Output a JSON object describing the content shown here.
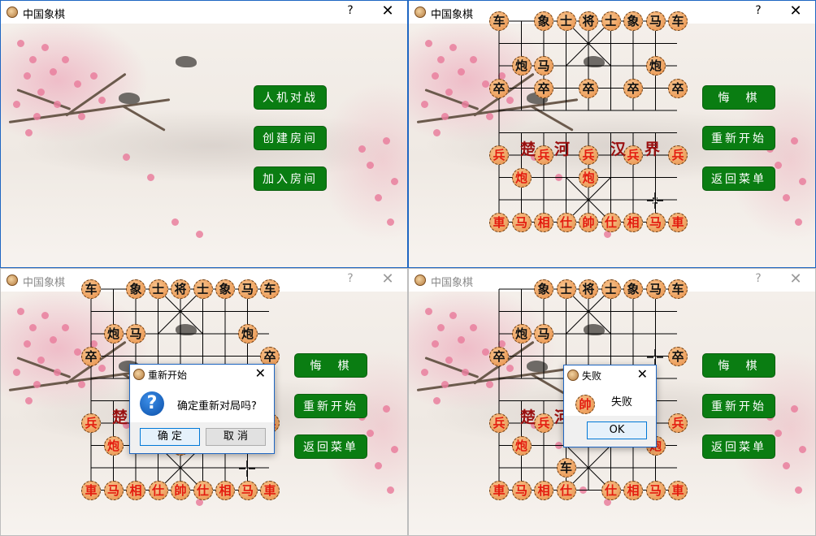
{
  "app": {
    "title": "中国象棋",
    "help_glyph": "?",
    "close_glyph": "✕"
  },
  "menu_window": {
    "buttons": [
      {
        "label": "人机对战"
      },
      {
        "label": "创建房间"
      },
      {
        "label": "加入房间"
      }
    ]
  },
  "game_buttons": [
    {
      "label": "悔　棋"
    },
    {
      "label": "重新开始"
    },
    {
      "label": "返回菜单"
    }
  ],
  "river": {
    "left": "楚　河",
    "right": "汉　界"
  },
  "boards": [
    {
      "pieces": [
        {
          "t": "车",
          "s": "black",
          "c": 0,
          "r": 0
        },
        {
          "t": "象",
          "s": "black",
          "c": 2,
          "r": 0
        },
        {
          "t": "士",
          "s": "black",
          "c": 3,
          "r": 0
        },
        {
          "t": "将",
          "s": "black",
          "c": 4,
          "r": 0
        },
        {
          "t": "士",
          "s": "black",
          "c": 5,
          "r": 0
        },
        {
          "t": "象",
          "s": "black",
          "c": 6,
          "r": 0
        },
        {
          "t": "马",
          "s": "black",
          "c": 7,
          "r": 0
        },
        {
          "t": "车",
          "s": "black",
          "c": 8,
          "r": 0
        },
        {
          "t": "炮",
          "s": "black",
          "c": 1,
          "r": 2
        },
        {
          "t": "马",
          "s": "black",
          "c": 2,
          "r": 2
        },
        {
          "t": "炮",
          "s": "black",
          "c": 7,
          "r": 2
        },
        {
          "t": "卒",
          "s": "black",
          "c": 0,
          "r": 3
        },
        {
          "t": "卒",
          "s": "black",
          "c": 2,
          "r": 3
        },
        {
          "t": "卒",
          "s": "black",
          "c": 4,
          "r": 3
        },
        {
          "t": "卒",
          "s": "black",
          "c": 6,
          "r": 3
        },
        {
          "t": "卒",
          "s": "black",
          "c": 8,
          "r": 3
        },
        {
          "t": "兵",
          "s": "red",
          "c": 0,
          "r": 6
        },
        {
          "t": "兵",
          "s": "red",
          "c": 2,
          "r": 6
        },
        {
          "t": "兵",
          "s": "red",
          "c": 4,
          "r": 6
        },
        {
          "t": "兵",
          "s": "red",
          "c": 6,
          "r": 6
        },
        {
          "t": "兵",
          "s": "red",
          "c": 8,
          "r": 6
        },
        {
          "t": "炮",
          "s": "red",
          "c": 1,
          "r": 7
        },
        {
          "t": "炮",
          "s": "red",
          "c": 4,
          "r": 7
        },
        {
          "t": "車",
          "s": "red",
          "c": 0,
          "r": 9
        },
        {
          "t": "马",
          "s": "red",
          "c": 1,
          "r": 9
        },
        {
          "t": "相",
          "s": "red",
          "c": 2,
          "r": 9
        },
        {
          "t": "仕",
          "s": "red",
          "c": 3,
          "r": 9
        },
        {
          "t": "帥",
          "s": "red",
          "c": 4,
          "r": 9
        },
        {
          "t": "仕",
          "s": "red",
          "c": 5,
          "r": 9
        },
        {
          "t": "相",
          "s": "red",
          "c": 6,
          "r": 9
        },
        {
          "t": "马",
          "s": "red",
          "c": 7,
          "r": 9
        },
        {
          "t": "車",
          "s": "red",
          "c": 8,
          "r": 9
        }
      ]
    },
    {
      "pieces": [
        {
          "t": "车",
          "s": "black",
          "c": 0,
          "r": 0
        },
        {
          "t": "象",
          "s": "black",
          "c": 2,
          "r": 0
        },
        {
          "t": "士",
          "s": "black",
          "c": 3,
          "r": 0
        },
        {
          "t": "将",
          "s": "black",
          "c": 4,
          "r": 0
        },
        {
          "t": "士",
          "s": "black",
          "c": 5,
          "r": 0
        },
        {
          "t": "象",
          "s": "black",
          "c": 6,
          "r": 0
        },
        {
          "t": "马",
          "s": "black",
          "c": 7,
          "r": 0
        },
        {
          "t": "车",
          "s": "black",
          "c": 8,
          "r": 0
        },
        {
          "t": "炮",
          "s": "black",
          "c": 1,
          "r": 2
        },
        {
          "t": "马",
          "s": "black",
          "c": 2,
          "r": 2
        },
        {
          "t": "炮",
          "s": "black",
          "c": 7,
          "r": 2
        },
        {
          "t": "卒",
          "s": "black",
          "c": 0,
          "r": 3
        },
        {
          "t": "卒",
          "s": "black",
          "c": 8,
          "r": 3
        },
        {
          "t": "兵",
          "s": "red",
          "c": 0,
          "r": 6
        },
        {
          "t": "兵",
          "s": "red",
          "c": 8,
          "r": 6
        },
        {
          "t": "炮",
          "s": "red",
          "c": 1,
          "r": 7
        },
        {
          "t": "炮",
          "s": "red",
          "c": 4,
          "r": 7
        },
        {
          "t": "車",
          "s": "red",
          "c": 0,
          "r": 9
        },
        {
          "t": "马",
          "s": "red",
          "c": 1,
          "r": 9
        },
        {
          "t": "相",
          "s": "red",
          "c": 2,
          "r": 9
        },
        {
          "t": "仕",
          "s": "red",
          "c": 3,
          "r": 9
        },
        {
          "t": "帥",
          "s": "red",
          "c": 4,
          "r": 9
        },
        {
          "t": "仕",
          "s": "red",
          "c": 5,
          "r": 9
        },
        {
          "t": "相",
          "s": "red",
          "c": 6,
          "r": 9
        },
        {
          "t": "马",
          "s": "red",
          "c": 7,
          "r": 9
        },
        {
          "t": "車",
          "s": "red",
          "c": 8,
          "r": 9
        }
      ]
    },
    {
      "pieces": [
        {
          "t": "象",
          "s": "black",
          "c": 2,
          "r": 0
        },
        {
          "t": "士",
          "s": "black",
          "c": 3,
          "r": 0
        },
        {
          "t": "将",
          "s": "black",
          "c": 4,
          "r": 0
        },
        {
          "t": "士",
          "s": "black",
          "c": 5,
          "r": 0
        },
        {
          "t": "象",
          "s": "black",
          "c": 6,
          "r": 0
        },
        {
          "t": "马",
          "s": "black",
          "c": 7,
          "r": 0
        },
        {
          "t": "车",
          "s": "black",
          "c": 8,
          "r": 0
        },
        {
          "t": "炮",
          "s": "black",
          "c": 1,
          "r": 2
        },
        {
          "t": "马",
          "s": "black",
          "c": 2,
          "r": 2
        },
        {
          "t": "卒",
          "s": "black",
          "c": 0,
          "r": 3
        },
        {
          "t": "卒",
          "s": "black",
          "c": 8,
          "r": 3
        },
        {
          "t": "兵",
          "s": "red",
          "c": 0,
          "r": 6
        },
        {
          "t": "兵",
          "s": "red",
          "c": 2,
          "r": 6
        },
        {
          "t": "兵",
          "s": "red",
          "c": 8,
          "r": 6
        },
        {
          "t": "炮",
          "s": "red",
          "c": 1,
          "r": 7
        },
        {
          "t": "炮",
          "s": "red",
          "c": 7,
          "r": 7
        },
        {
          "t": "车",
          "s": "black",
          "c": 3,
          "r": 8
        },
        {
          "t": "車",
          "s": "red",
          "c": 0,
          "r": 9
        },
        {
          "t": "马",
          "s": "red",
          "c": 1,
          "r": 9
        },
        {
          "t": "相",
          "s": "red",
          "c": 2,
          "r": 9
        },
        {
          "t": "仕",
          "s": "red",
          "c": 3,
          "r": 9
        },
        {
          "t": "仕",
          "s": "red",
          "c": 5,
          "r": 9
        },
        {
          "t": "相",
          "s": "red",
          "c": 6,
          "r": 9
        },
        {
          "t": "马",
          "s": "red",
          "c": 7,
          "r": 9
        },
        {
          "t": "車",
          "s": "red",
          "c": 8,
          "r": 9
        }
      ]
    }
  ],
  "restart_dialog": {
    "title": "重新开始",
    "icon_glyph": "?",
    "message": "确定重新对局吗?",
    "ok_label": "确 定",
    "cancel_label": "取 消"
  },
  "lose_dialog": {
    "title": "失败",
    "piece_glyph": "帥",
    "message": "失败",
    "ok_label": "OK"
  }
}
